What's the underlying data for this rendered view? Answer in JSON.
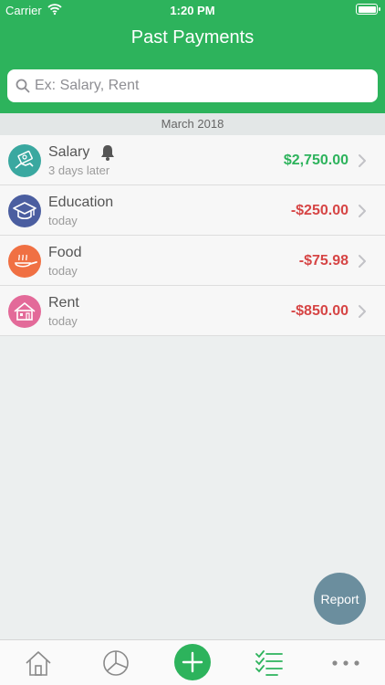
{
  "status": {
    "carrier": "Carrier",
    "time": "1:20 PM"
  },
  "header": {
    "title": "Past Payments"
  },
  "search": {
    "placeholder": "Ex: Salary, Rent"
  },
  "section": {
    "label": "March 2018"
  },
  "payments": [
    {
      "title": "Salary",
      "subtitle": "3 days later",
      "amount": "$2,750.00",
      "kind": "income",
      "icon": "salary-icon",
      "color": "#3aa8a0",
      "reminder": true
    },
    {
      "title": "Education",
      "subtitle": "today",
      "amount": "-$250.00",
      "kind": "expense",
      "icon": "graduation-cap-icon",
      "color": "#4b5ea0",
      "reminder": false
    },
    {
      "title": "Food",
      "subtitle": "today",
      "amount": "-$75.98",
      "kind": "expense",
      "icon": "food-pan-icon",
      "color": "#f07043",
      "reminder": false
    },
    {
      "title": "Rent",
      "subtitle": "today",
      "amount": "-$850.00",
      "kind": "expense",
      "icon": "house-icon",
      "color": "#e36a99",
      "reminder": false
    }
  ],
  "report_button": {
    "label": "Report"
  },
  "tabbar": {
    "items": [
      "home-icon",
      "pie-chart-icon",
      "add-icon",
      "checklist-icon",
      "more-icon"
    ],
    "active": "checklist-icon",
    "accent": "#2db35c"
  }
}
